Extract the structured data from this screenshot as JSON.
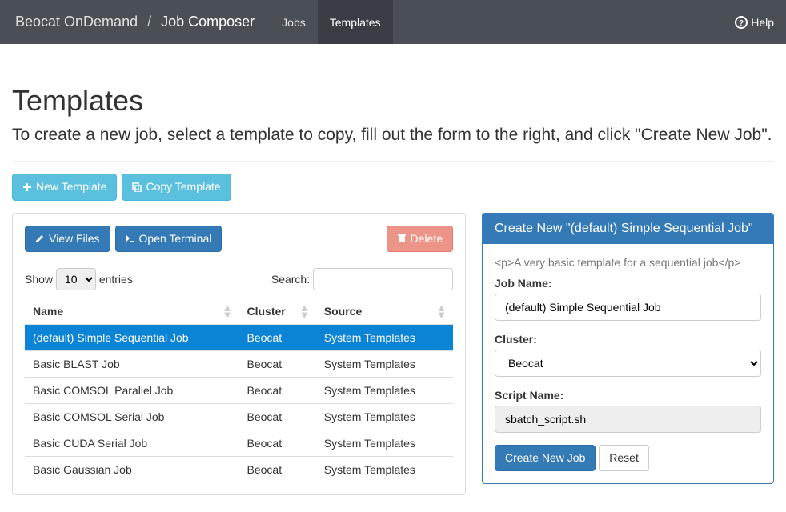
{
  "navbar": {
    "brand": "Beocat OnDemand",
    "page": "Job Composer",
    "links": {
      "jobs": "Jobs",
      "templates": "Templates"
    },
    "help": "Help"
  },
  "header": {
    "title": "Templates",
    "subtitle": "To create a new job, select a template to copy, fill out the form to the right, and click \"Create New Job\"."
  },
  "toolbar": {
    "new_template": "New Template",
    "copy_template": "Copy Template"
  },
  "inner_toolbar": {
    "view_files": "View Files",
    "open_terminal": "Open Terminal",
    "delete": "Delete"
  },
  "datatable": {
    "show_prefix": "Show",
    "entries_suffix": "entries",
    "page_length": "10",
    "search_label": "Search:",
    "search_value": "",
    "columns": {
      "name": "Name",
      "cluster": "Cluster",
      "source": "Source"
    },
    "rows": [
      {
        "name": "(default) Simple Sequential Job",
        "cluster": "Beocat",
        "source": "System Templates",
        "selected": true
      },
      {
        "name": "Basic BLAST Job",
        "cluster": "Beocat",
        "source": "System Templates",
        "selected": false
      },
      {
        "name": "Basic COMSOL Parallel Job",
        "cluster": "Beocat",
        "source": "System Templates",
        "selected": false
      },
      {
        "name": "Basic COMSOL Serial Job",
        "cluster": "Beocat",
        "source": "System Templates",
        "selected": false
      },
      {
        "name": "Basic CUDA Serial Job",
        "cluster": "Beocat",
        "source": "System Templates",
        "selected": false
      },
      {
        "name": "Basic Gaussian Job",
        "cluster": "Beocat",
        "source": "System Templates",
        "selected": false
      }
    ]
  },
  "form": {
    "panel_title": "Create New \"(default) Simple Sequential Job\"",
    "notes": "<p>A very basic template for a sequential job</p>",
    "job_name_label": "Job Name:",
    "job_name_value": "(default) Simple Sequential Job",
    "cluster_label": "Cluster:",
    "cluster_value": "Beocat",
    "script_name_label": "Script Name:",
    "script_name_value": "sbatch_script.sh",
    "submit": "Create New Job",
    "reset": "Reset"
  }
}
